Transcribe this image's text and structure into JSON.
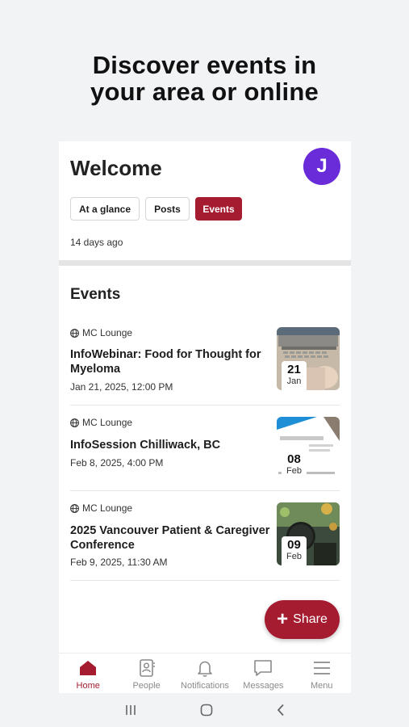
{
  "headline": {
    "line1": "Discover events in",
    "line2": "your area or online"
  },
  "welcome": {
    "title": "Welcome",
    "avatar_initial": "J",
    "tabs": [
      {
        "label": "At a glance"
      },
      {
        "label": "Posts"
      },
      {
        "label": "Events"
      }
    ],
    "time_ago": "14 days ago"
  },
  "events": {
    "heading": "Events",
    "items": [
      {
        "location": "MC Lounge",
        "title": "InfoWebinar: Food for Thought for Myeloma",
        "date": "Jan 21, 2025, 12:00 PM",
        "day": "21",
        "month": "Jan"
      },
      {
        "location": "MC Lounge",
        "title": "InfoSession Chilliwack, BC",
        "date": "Feb 8, 2025, 4:00 PM",
        "day": "08",
        "month": "Feb"
      },
      {
        "location": "MC Lounge",
        "title": "2025 Vancouver Patient & Caregiver Conference",
        "date": "Feb 9, 2025, 11:30 AM",
        "day": "09",
        "month": "Feb"
      }
    ]
  },
  "share": {
    "label": "Share"
  },
  "nav": {
    "items": [
      {
        "label": "Home",
        "icon": "home-icon"
      },
      {
        "label": "People",
        "icon": "people-icon"
      },
      {
        "label": "Notifications",
        "icon": "bell-icon"
      },
      {
        "label": "Messages",
        "icon": "chat-icon"
      },
      {
        "label": "Menu",
        "icon": "menu-icon"
      }
    ]
  },
  "colors": {
    "accent": "#a51c30",
    "avatar": "#6a2bd9"
  }
}
